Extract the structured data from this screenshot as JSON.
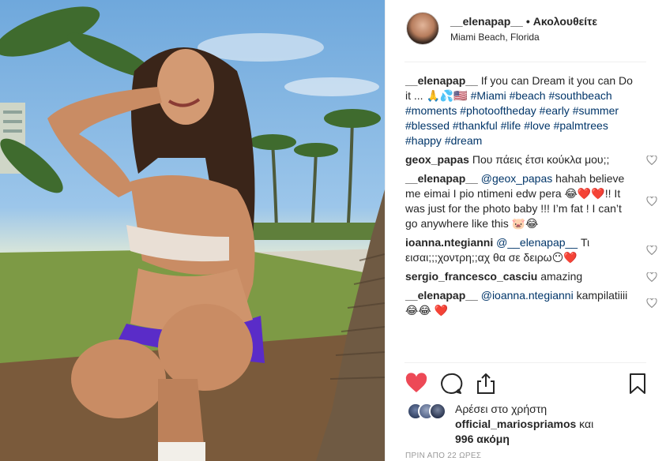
{
  "header": {
    "username": "__elenapap__",
    "follow_label": "Ακολουθείτε",
    "location": "Miami Beach, Florida"
  },
  "comments": [
    {
      "user": "__elenapap__",
      "text": "If you can Dream it you can Do it ... 🙏💦🇺🇸",
      "hashtags": "#Miami #beach #southbeach #moments #photooftheday #early #summer #blessed #thankful #life #love #palmtrees #happy #dream"
    },
    {
      "user": "geox_papas",
      "mention": "",
      "text": "Που πάεις έτσι κούκλα μου;;"
    },
    {
      "user": "__elenapap__",
      "mention": "@geox_papas",
      "text": "hahah believe me eimai I pio ntimeni edw pera 😂❤️❤️!! It was just for the photo baby !!! I’m fat ! I can’t go anywhere like this 🐷😂"
    },
    {
      "user": "ioanna.ntegianni",
      "mention": "@__elenapap__",
      "text": "Τι εισαι;;;χοντρη;;αχ θα σε δειρω😶❤️"
    },
    {
      "user": "sergio_francesco_casciu",
      "mention": "",
      "text": "amazing"
    },
    {
      "user": "__elenapap__",
      "mention": "@ioanna.ntegianni",
      "text": "kampilatiiii 😂😂 ❤️"
    }
  ],
  "likes": {
    "prefix": "Αρέσει στο χρήστη",
    "user": "official_mariospriamos",
    "conj": "και",
    "count": "996 ακόμη"
  },
  "timestamp": "ΠΡΙΝ ΑΠΟ 22 ΩΡΕΣ",
  "colors": {
    "like_red": "#ed4956",
    "link": "#003569",
    "muted": "#999999"
  },
  "icons": [
    "heart-icon",
    "comment-icon",
    "share-icon",
    "bookmark-icon"
  ]
}
